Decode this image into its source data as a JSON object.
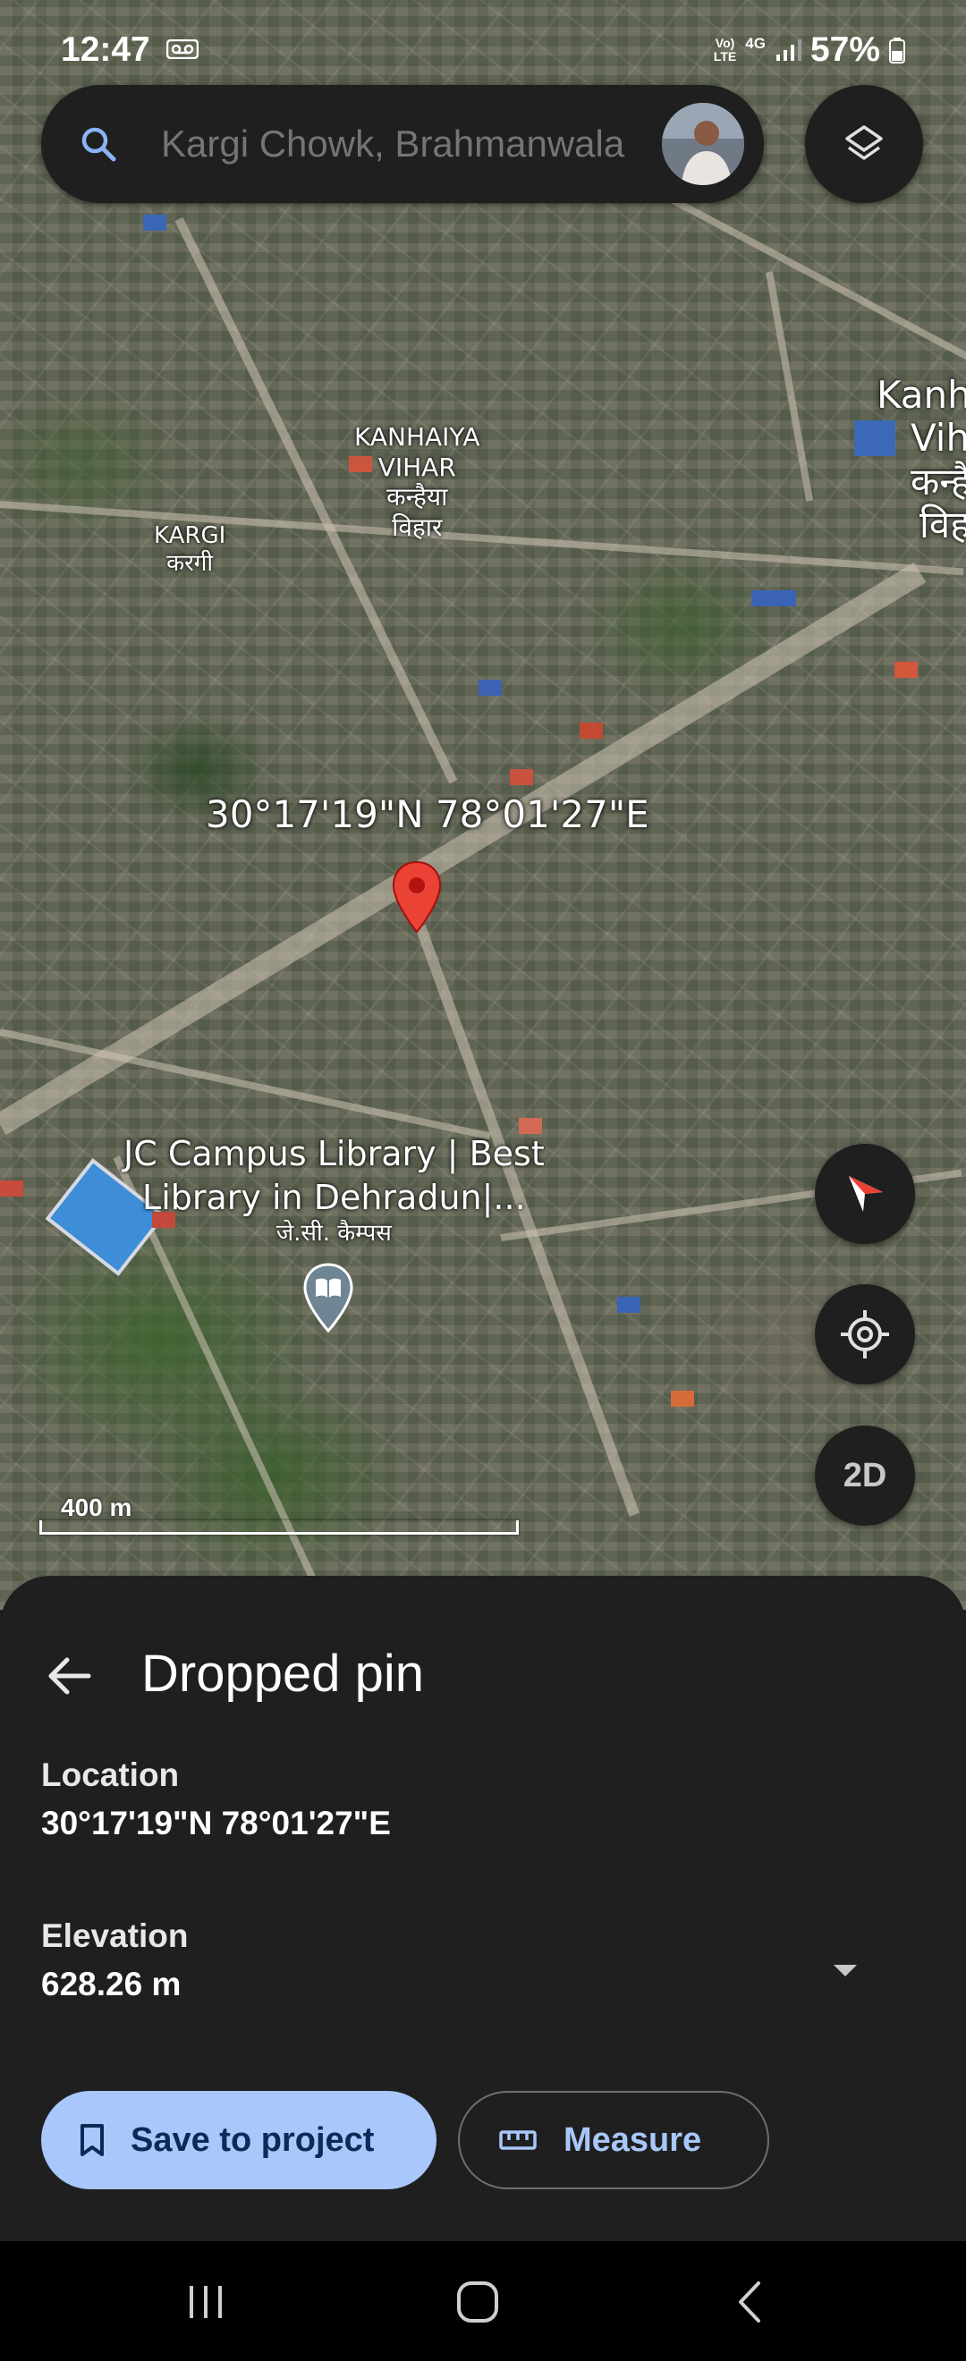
{
  "status_bar": {
    "time": "12:47",
    "network_top": "Vo)",
    "network_bottom": "LTE",
    "network_type": "4G",
    "battery": "57%",
    "icons": [
      "voicemail-icon",
      "signal-icon",
      "battery-icon"
    ]
  },
  "search": {
    "placeholder": "Kargi Chowk, Brahmanwala",
    "icon": "search-icon"
  },
  "layers": {
    "icon": "layers-icon"
  },
  "map": {
    "coordinate_label": "30°17'19\"N 78°01'27\"E",
    "places": [
      {
        "line1": "KANHAIYA",
        "line2": "VIHAR",
        "line3": "कन्हैया",
        "line4": "विहार"
      },
      {
        "line1": "KARGI",
        "line2": "करगी"
      },
      {
        "line1": "Kanh",
        "line2": "Vih",
        "line3": "कन्है",
        "line4": "विह"
      }
    ],
    "poi": {
      "line1": "JC Campus Library | Best",
      "line2": "Library in Dehradun|...",
      "line3": "जे.सी. कैम्पस",
      "icon": "book-pin-icon"
    },
    "scale": "400 m",
    "controls": {
      "compass_icon": "compass-icon",
      "location_icon": "my-location-icon",
      "view_mode": "2D"
    }
  },
  "sheet": {
    "title": "Dropped pin",
    "location_label": "Location",
    "location_value": "30°17'19\"N 78°01'27\"E",
    "elevation_label": "Elevation",
    "elevation_value": "628.26 m",
    "save_button": "Save to project",
    "measure_button": "Measure"
  },
  "nav_bar": {
    "icons": [
      "recents-icon",
      "home-icon",
      "back-icon"
    ]
  },
  "colors": {
    "sheet_bg": "#1f1f1f",
    "accent": "#a8c7fa",
    "pin_red": "#ea4335"
  }
}
